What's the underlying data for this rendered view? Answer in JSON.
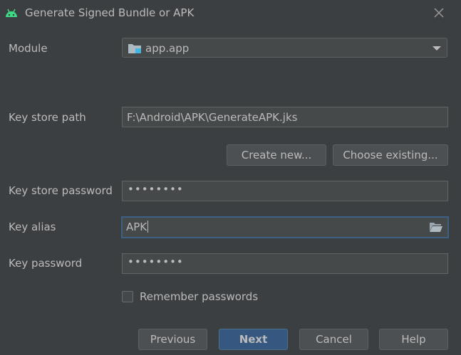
{
  "window": {
    "title": "Generate Signed Bundle or APK",
    "app_icon": "android-icon",
    "close_icon": "close-icon"
  },
  "module": {
    "label": "Module",
    "value": "app.app",
    "icon": "module-folder-icon"
  },
  "keystore": {
    "path_label": "Key store path",
    "path_value": "F:\\Android\\APK\\GenerateAPK.jks",
    "create_new_label": "Create new...",
    "choose_existing_label": "Choose existing...",
    "password_label": "Key store password",
    "password_value": "••••••••"
  },
  "key": {
    "alias_label": "Key alias",
    "alias_value": "APK",
    "password_label": "Key password",
    "password_value": "••••••••"
  },
  "remember": {
    "label": "Remember passwords",
    "checked": false
  },
  "footer": {
    "previous_label": "Previous",
    "next_label": "Next",
    "cancel_label": "Cancel",
    "help_label": "Help"
  },
  "colors": {
    "background": "#3c3f41",
    "field": "#45494a",
    "primary_button": "#365880",
    "focus_border": "#3d6185",
    "android_green": "#3ddc84"
  }
}
